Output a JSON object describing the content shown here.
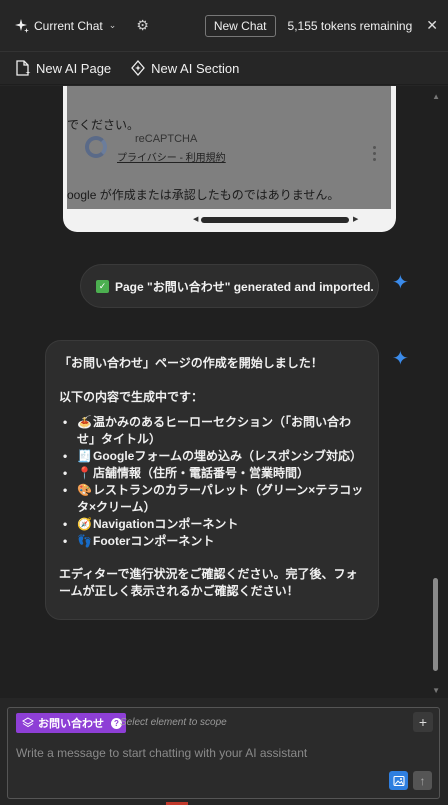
{
  "topbar": {
    "current_chat_label": "Current Chat",
    "new_chat_label": "New Chat",
    "tokens_label": "5,155 tokens remaining"
  },
  "actions": {
    "new_ai_page": "New AI Page",
    "new_ai_section": "New AI Section"
  },
  "preview": {
    "top_text": "でください。",
    "recaptcha_title": "reCAPTCHA",
    "recaptcha_links": "プライバシー - 利用規約",
    "bottom_text": "oogle が作成または承認したものではありません。"
  },
  "messages": {
    "generated_text": "Page \"お問い合わせ\" generated and imported.",
    "intro": "「お問い合わせ」ページの作成を開始しました！",
    "list_heading": "以下の内容で生成中です：",
    "items": [
      {
        "icon": "🍝",
        "text": "温かみのあるヒーローセクション（「お問い合わせ」タイトル）"
      },
      {
        "icon": "🧾",
        "text": "Googleフォームの埋め込み（レスポンシブ対応）"
      },
      {
        "icon": "📍",
        "text": "店舗情報（住所・電話番号・営業時間）"
      },
      {
        "icon": "🎨",
        "text": "レストランのカラーパレット（グリーン×テラコッタ×クリーム）"
      },
      {
        "icon": "🧭",
        "text": "Navigationコンポーネント"
      },
      {
        "icon": "👣",
        "text": "Footerコンポーネント"
      }
    ],
    "closing": "エディターで進行状況をご確認ください。完了後、フォームが正しく表示されるかご確認ください！"
  },
  "composer": {
    "scope_tag": "お問い合わせ",
    "scope_hint": "Select element to scope",
    "input_placeholder": "Write a message to start chatting with your AI assistant"
  },
  "colors": {
    "accent_blue": "#2f7fe0",
    "scope_purple": "#8e3fd6",
    "check_green": "#4caf50"
  }
}
